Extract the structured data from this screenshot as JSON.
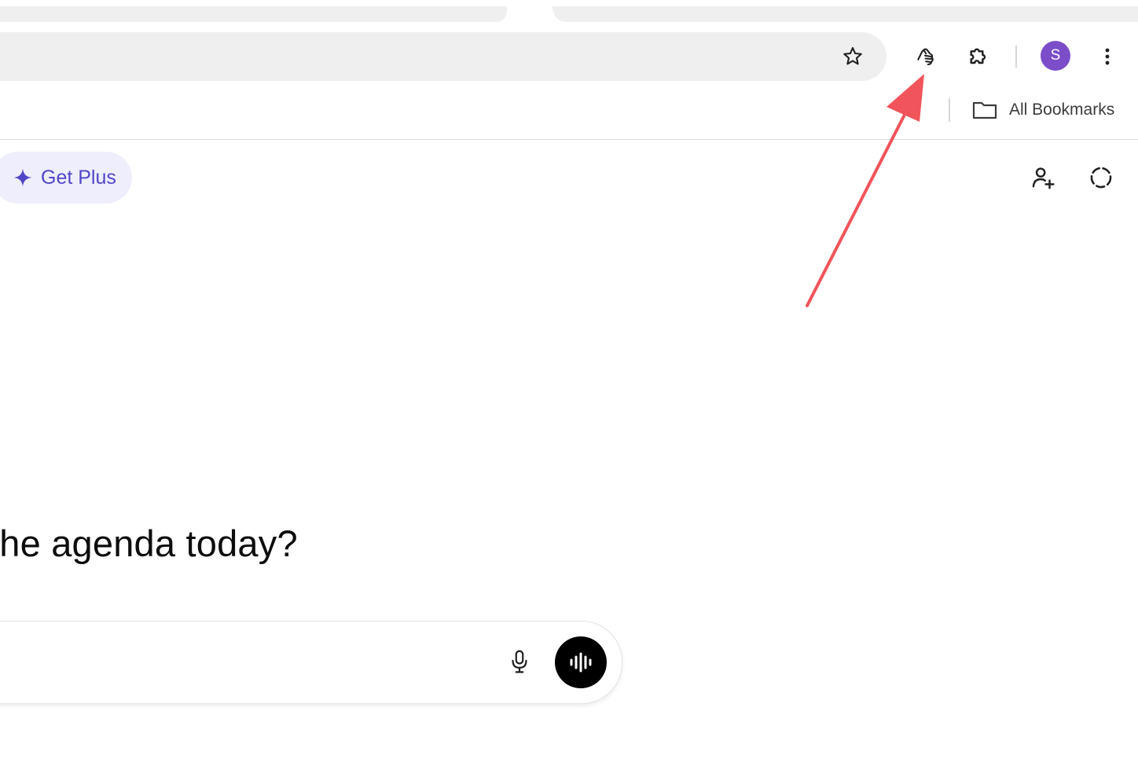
{
  "browser": {
    "avatar_letter": "S",
    "avatar_color": "#7b4dc9",
    "toolbar_icons": [
      "star-icon",
      "hand-extension-icon",
      "puzzle-icon",
      "kebab-menu-icon"
    ],
    "bookmarks_bar": {
      "all_bookmarks_label": "All Bookmarks",
      "folder_icon": "folder-icon"
    }
  },
  "page": {
    "get_plus_label": "Get Plus",
    "get_plus_icon": "sparkle-icon",
    "get_plus_color": "#5046c8",
    "header_icons": [
      "add-person-icon",
      "dashed-circle-icon"
    ],
    "greeting_text": "the agenda today?",
    "composer": {
      "icons": [
        "microphone-icon",
        "voice-wave-icon"
      ]
    }
  },
  "annotation": {
    "type": "arrow",
    "color": "#f2545b",
    "points_to": "hand-extension-icon"
  }
}
